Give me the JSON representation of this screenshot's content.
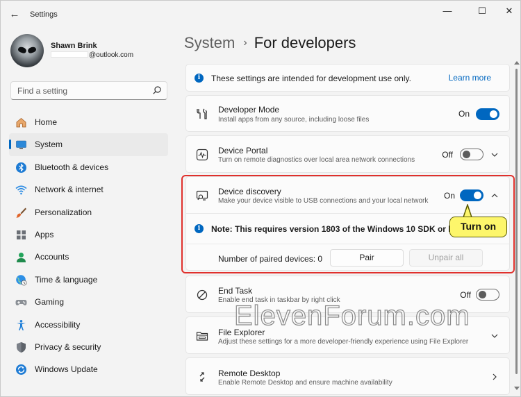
{
  "window": {
    "title": "Settings",
    "back_glyph": "←",
    "minimize_glyph": "—",
    "maximize_glyph": "☐",
    "close_glyph": "✕"
  },
  "profile": {
    "name": "Shawn Brink",
    "email_suffix": "@outlook.com"
  },
  "search": {
    "placeholder": "Find a setting"
  },
  "sidebar": {
    "items": [
      {
        "label": "Home",
        "icon": "home-icon",
        "active": false
      },
      {
        "label": "System",
        "icon": "system-icon",
        "active": true
      },
      {
        "label": "Bluetooth & devices",
        "icon": "bluetooth-icon",
        "active": false
      },
      {
        "label": "Network & internet",
        "icon": "wifi-icon",
        "active": false
      },
      {
        "label": "Personalization",
        "icon": "brush-icon",
        "active": false
      },
      {
        "label": "Apps",
        "icon": "apps-icon",
        "active": false
      },
      {
        "label": "Accounts",
        "icon": "account-icon",
        "active": false
      },
      {
        "label": "Time & language",
        "icon": "globe-clock-icon",
        "active": false
      },
      {
        "label": "Gaming",
        "icon": "gamepad-icon",
        "active": false
      },
      {
        "label": "Accessibility",
        "icon": "accessibility-icon",
        "active": false
      },
      {
        "label": "Privacy & security",
        "icon": "shield-icon",
        "active": false
      },
      {
        "label": "Windows Update",
        "icon": "update-icon",
        "active": false
      }
    ]
  },
  "breadcrumb": {
    "parent": "System",
    "separator": "›",
    "current": "For developers"
  },
  "info_banner": {
    "text": "These settings are intended for development use only.",
    "link": "Learn more"
  },
  "developer_mode": {
    "title": "Developer Mode",
    "description": "Install apps from any source, including loose files",
    "state": "On"
  },
  "device_portal": {
    "title": "Device Portal",
    "description": "Turn on remote diagnostics over local area network connections",
    "state": "Off"
  },
  "device_discovery": {
    "title": "Device discovery",
    "description": "Make your device visible to USB connections and your local network",
    "state": "On",
    "note": "Note: This requires version 1803 of the Windows 10 SDK or later.",
    "paired_label": "Number of paired devices: 0",
    "pair_button": "Pair",
    "unpair_button": "Unpair all"
  },
  "end_task": {
    "title": "End Task",
    "description": "Enable end task in taskbar by right click",
    "state": "Off"
  },
  "file_explorer": {
    "title": "File Explorer",
    "description": "Adjust these settings for a more developer-friendly experience using File Explorer"
  },
  "remote_desktop": {
    "title": "Remote Desktop",
    "description": "Enable Remote Desktop and ensure machine availability"
  },
  "annotation": {
    "callout": "Turn on",
    "highlight_color": "#e0302c",
    "callout_color": "#fdf66b"
  },
  "watermark": "ElevenForum.com",
  "colors": {
    "accent": "#0067c0",
    "background": "#f3f3f3",
    "card": "#fbfbfb"
  }
}
